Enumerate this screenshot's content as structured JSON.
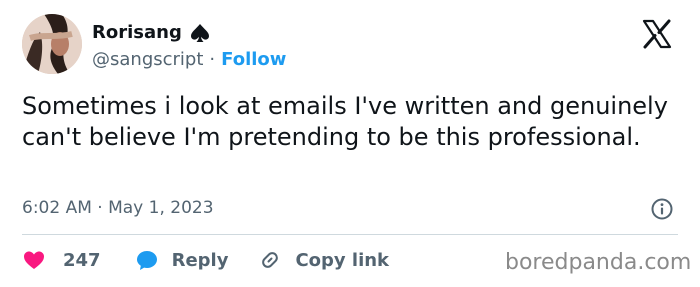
{
  "user": {
    "display_name": "Rorisang",
    "handle": "@sangscript",
    "separator": "·",
    "follow_label": "Follow"
  },
  "tweet": {
    "text": "Sometimes i look at emails I've written and genuinely can't believe I'm pretending to be this professional.",
    "timestamp": "6:02 AM · May 1, 2023"
  },
  "actions": {
    "like_count": "247",
    "reply_label": "Reply",
    "copy_label": "Copy link"
  },
  "watermark": "boredpanda.com",
  "colors": {
    "like": "#f91880",
    "reply": "#1d9bf0",
    "follow": "#1d9bf0",
    "secondary_text": "#536471"
  },
  "icons": {
    "badge": "spade-icon",
    "brand": "x-logo-icon",
    "info": "info-icon",
    "like": "heart-icon",
    "reply": "reply-bubble-icon",
    "copy": "link-icon"
  }
}
